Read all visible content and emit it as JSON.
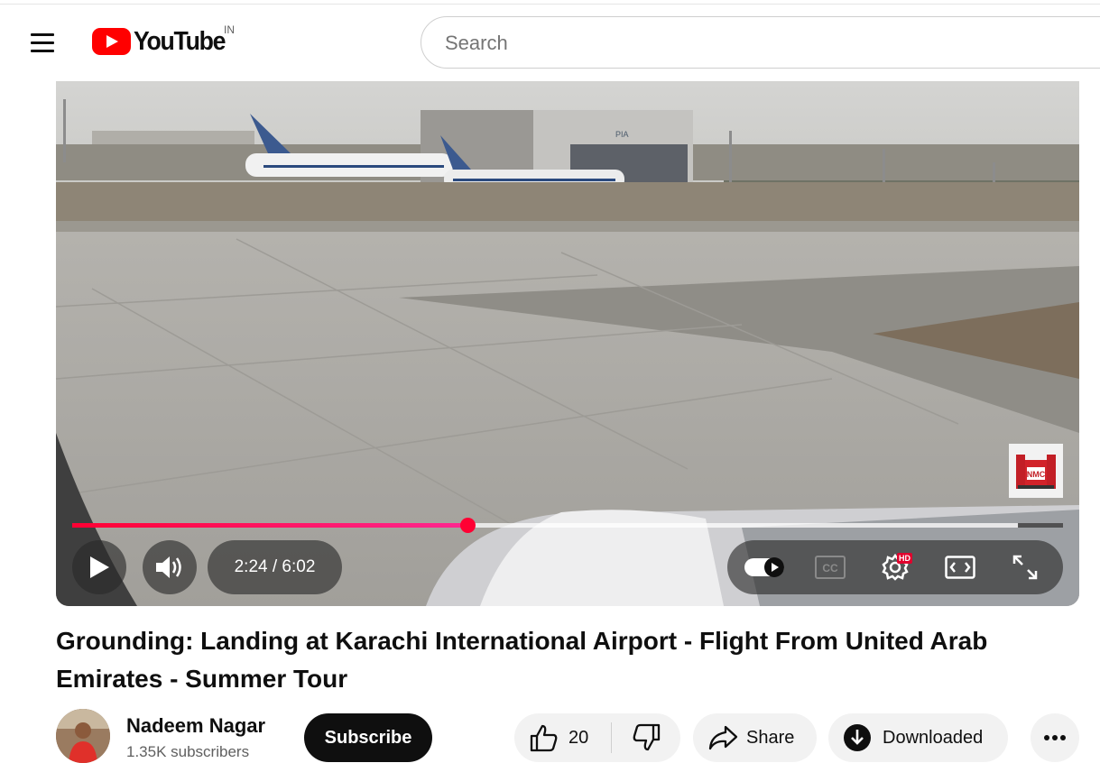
{
  "header": {
    "logo_text": "YouTube",
    "region": "IN",
    "search_placeholder": "Search"
  },
  "player": {
    "time_label": "2:24 / 6:02",
    "progress_fraction": 0.399,
    "buffered_fraction": 0.955,
    "hd_badge": "HD",
    "watermark_text": "NMC",
    "hangar_label": "PIA"
  },
  "video": {
    "title": "Grounding: Landing at Karachi International Airport - Flight From United Arab Emirates - Summer Tour"
  },
  "channel": {
    "name": "Nadeem Nagar",
    "subscribers": "1.35K subscribers",
    "subscribe_label": "Subscribe"
  },
  "actions": {
    "like_count": "20",
    "share_label": "Share",
    "download_label": "Downloaded"
  },
  "colors": {
    "progress": "#ff0033",
    "brand_red": "#ff0000"
  }
}
